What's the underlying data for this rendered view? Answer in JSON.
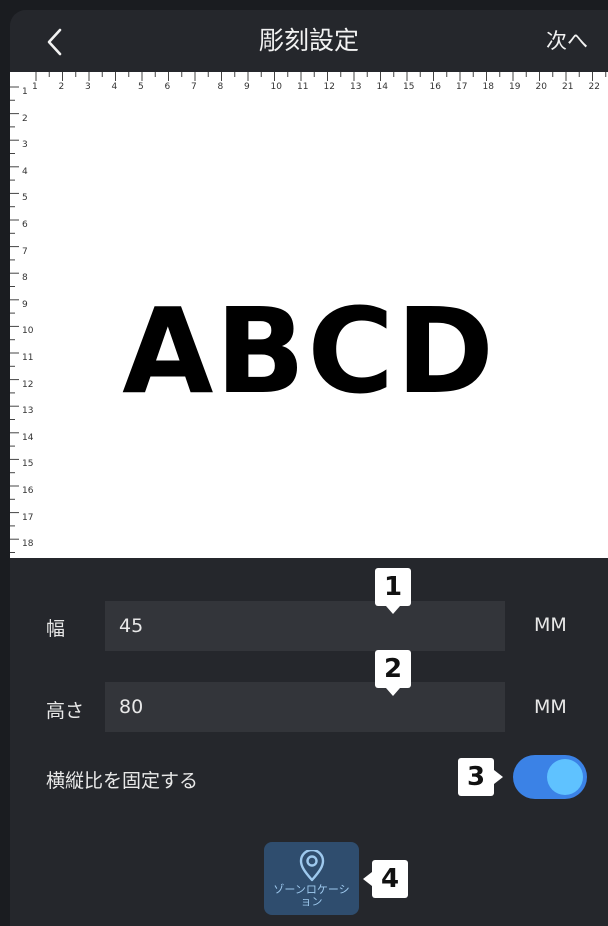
{
  "header": {
    "title": "彫刻設定",
    "next_label": "次へ",
    "back_icon": "chevron-left-icon"
  },
  "canvas": {
    "preview_text": "ABCD",
    "ruler_top_numbers": [
      "1",
      "2",
      "3",
      "4",
      "5",
      "6",
      "7",
      "8",
      "9",
      "10",
      "11",
      "12",
      "13",
      "14",
      "15",
      "16",
      "17",
      "18",
      "19",
      "20",
      "21",
      "22"
    ],
    "ruler_left_numbers": [
      "1",
      "2",
      "3",
      "4",
      "5",
      "6",
      "7",
      "8",
      "9",
      "10",
      "11",
      "12",
      "13",
      "14",
      "15",
      "16",
      "17",
      "18"
    ]
  },
  "form": {
    "width_label": "幅",
    "width_value": "45",
    "width_unit": "MM",
    "height_label": "高さ",
    "height_value": "80",
    "height_unit": "MM",
    "aspect_label": "横縦比を固定する",
    "aspect_locked": true,
    "zone_button_label": "ゾーンロケーション",
    "zone_icon": "location-pin-icon"
  },
  "callouts": {
    "c1": "1",
    "c2": "2",
    "c3": "3",
    "c4": "4"
  },
  "colors": {
    "background": "#25272c",
    "input_bg": "#33353a",
    "toggle_track": "#3b82e6",
    "toggle_knob": "#5fc2ff",
    "zone_button": "#2f4d6e"
  }
}
